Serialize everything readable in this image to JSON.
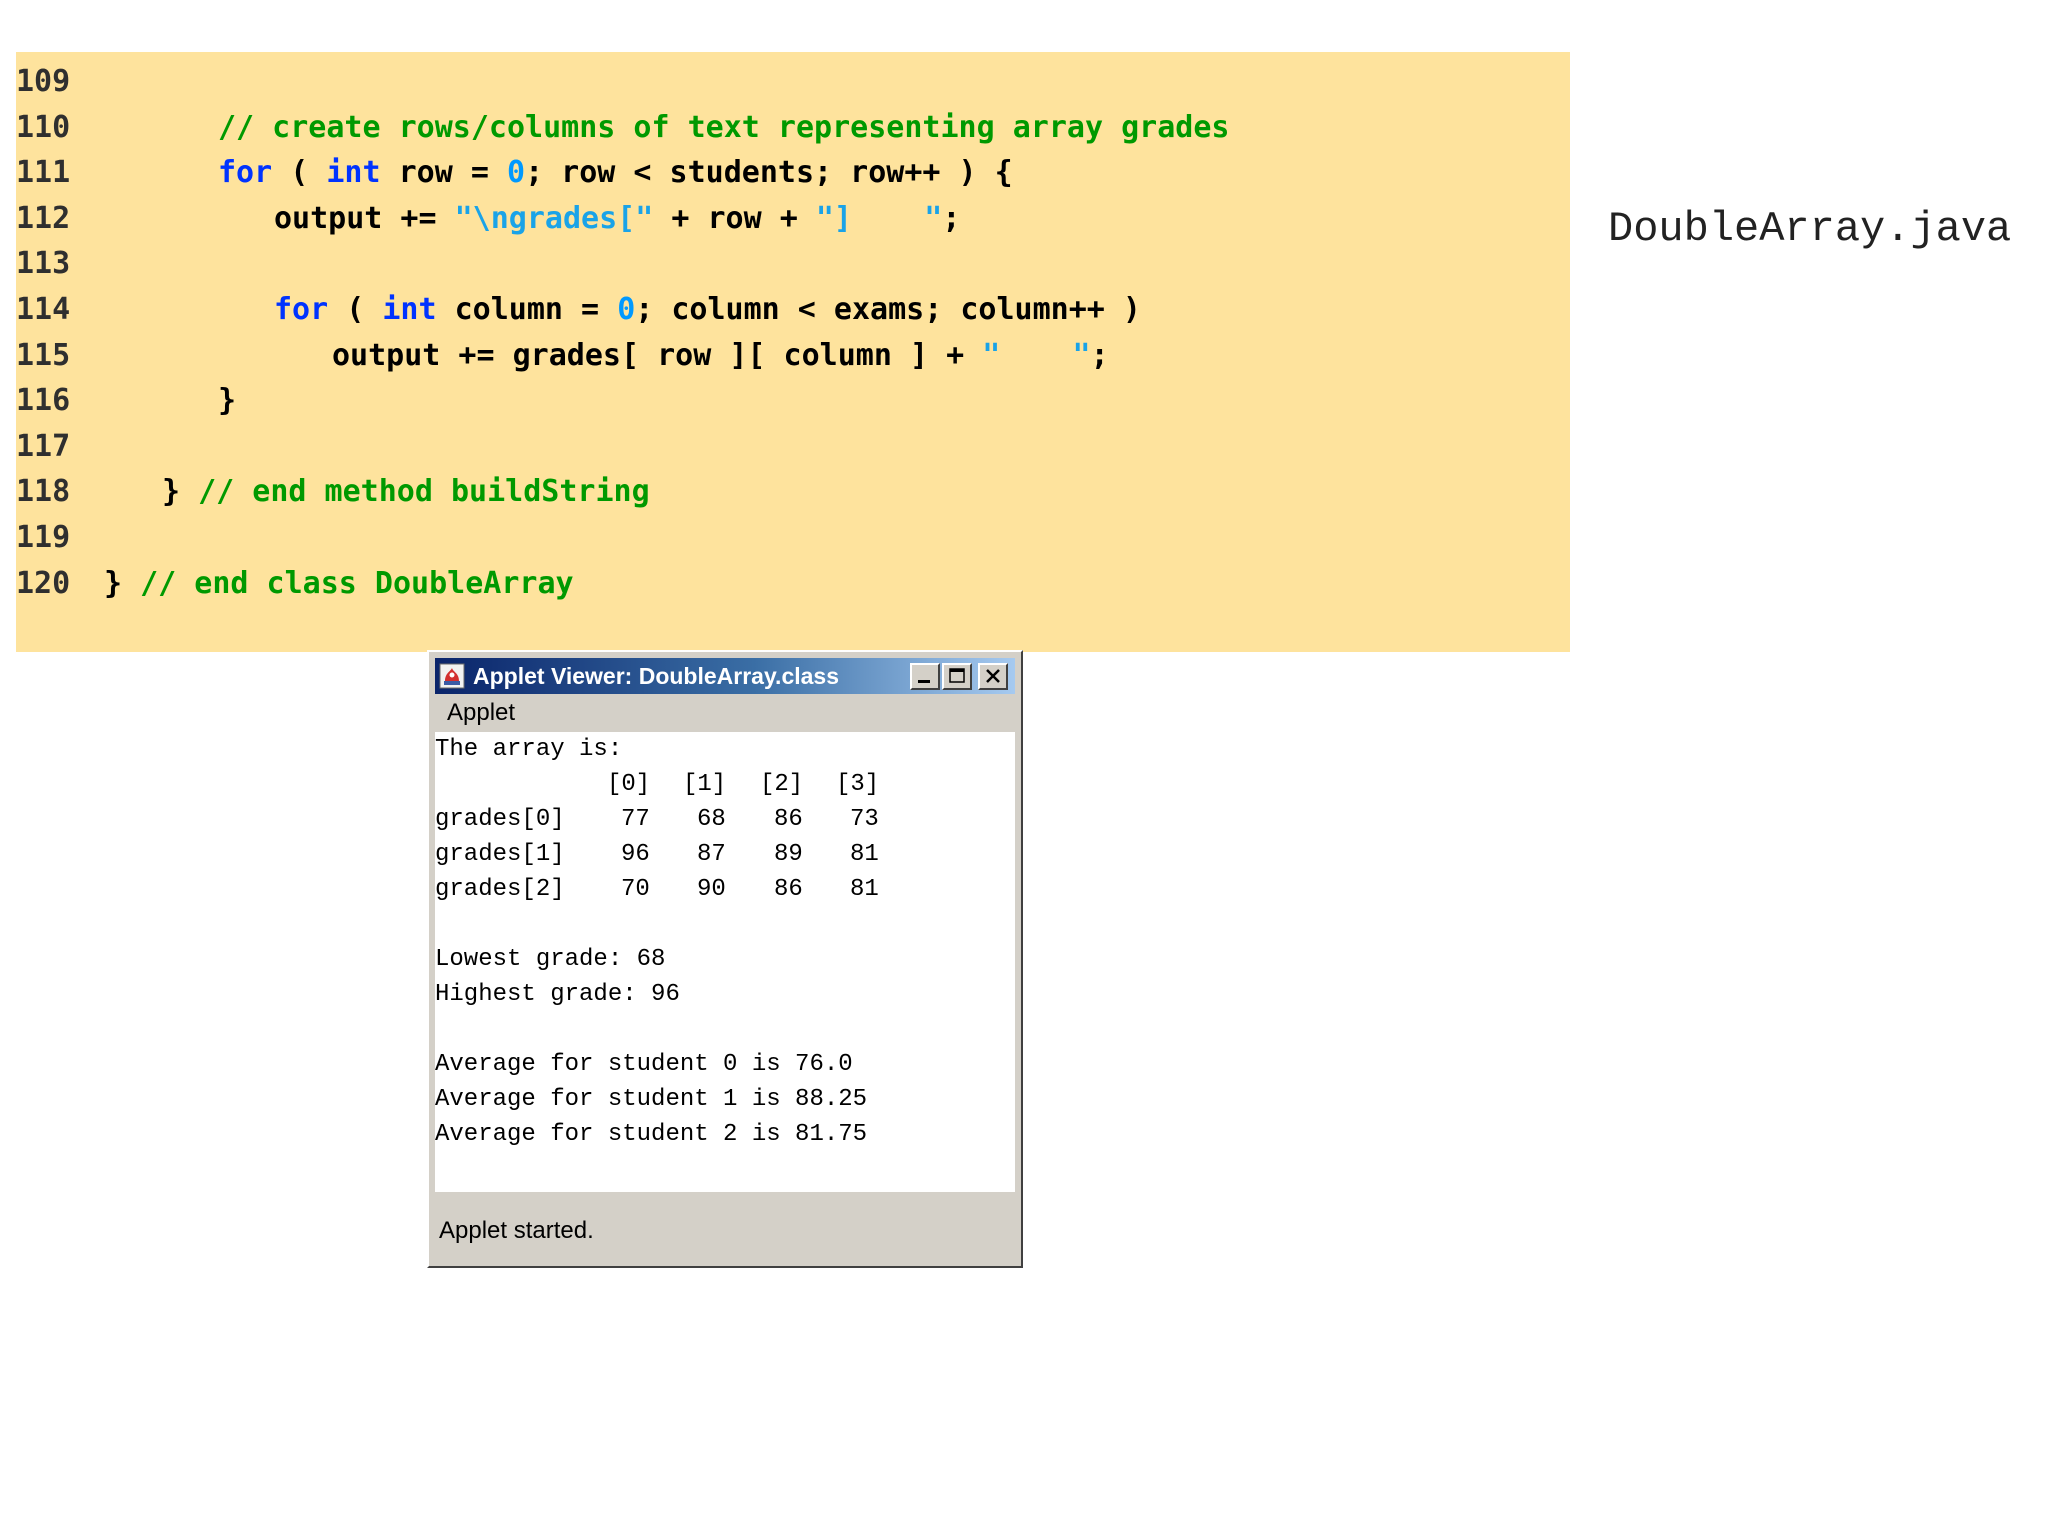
{
  "code": {
    "lines": [
      {
        "num": "109",
        "tokens": []
      },
      {
        "num": "110",
        "tokens": [
          {
            "t": "// create rows/columns of text representing array grades",
            "k": "comment"
          }
        ]
      },
      {
        "num": "111",
        "tokens": [
          {
            "t": "for",
            "k": "kw"
          },
          {
            "t": " ( ",
            "k": "plain"
          },
          {
            "t": "int",
            "k": "kw"
          },
          {
            "t": " row = ",
            "k": "plain"
          },
          {
            "t": "0",
            "k": "num"
          },
          {
            "t": "; row < students; row++ ) {",
            "k": "plain"
          }
        ]
      },
      {
        "num": "112",
        "tokens": [
          {
            "t": "output += ",
            "k": "plain"
          },
          {
            "t": "\"\\ngrades[\"",
            "k": "str"
          },
          {
            "t": " + row + ",
            "k": "plain"
          },
          {
            "t": "\"]    \"",
            "k": "str"
          },
          {
            "t": ";",
            "k": "plain"
          }
        ]
      },
      {
        "num": "113",
        "tokens": []
      },
      {
        "num": "114",
        "tokens": [
          {
            "t": "for",
            "k": "kw"
          },
          {
            "t": " ( ",
            "k": "plain"
          },
          {
            "t": "int",
            "k": "kw"
          },
          {
            "t": " column = ",
            "k": "plain"
          },
          {
            "t": "0",
            "k": "num"
          },
          {
            "t": "; column < exams; column++ )",
            "k": "plain"
          }
        ]
      },
      {
        "num": "115",
        "tokens": [
          {
            "t": "output += grades[ row ][ column ] + ",
            "k": "plain"
          },
          {
            "t": "\"    \"",
            "k": "str"
          },
          {
            "t": ";",
            "k": "plain"
          }
        ]
      },
      {
        "num": "116",
        "tokens": [
          {
            "t": "}",
            "k": "plain"
          }
        ]
      },
      {
        "num": "117",
        "tokens": []
      },
      {
        "num": "118",
        "tokens": [
          {
            "t": "} ",
            "k": "plain"
          },
          {
            "t": "// end method buildString",
            "k": "comment"
          }
        ]
      },
      {
        "num": "119",
        "tokens": []
      },
      {
        "num": "120",
        "tokens": [
          {
            "t": "} ",
            "k": "plain"
          },
          {
            "t": "// end class DoubleArray",
            "k": "comment"
          }
        ]
      }
    ]
  },
  "side_title": "DoubleArray.java",
  "window": {
    "title": "Applet Viewer: DoubleArray.class",
    "menu": [
      "Applet"
    ],
    "status": "Applet started.",
    "icons": [
      "java-applet-icon",
      "minimize-icon",
      "maximize-icon",
      "close-icon"
    ]
  },
  "output": {
    "heading": "The array is:",
    "column_headers": [
      "[0]",
      "[1]",
      "[2]",
      "[3]"
    ],
    "rows": [
      {
        "label": "grades[0]",
        "values": [
          "77",
          "68",
          "86",
          "73"
        ]
      },
      {
        "label": "grades[1]",
        "values": [
          "96",
          "87",
          "89",
          "81"
        ]
      },
      {
        "label": "grades[2]",
        "values": [
          "70",
          "90",
          "86",
          "81"
        ]
      }
    ],
    "lowest": "Lowest grade: 68",
    "highest": "Highest grade: 96",
    "averages": [
      "Average for student 0 is 76.0",
      "Average for student 1 is 88.25",
      "Average for student 2 is 81.75"
    ]
  },
  "colors": {
    "code_background": "#fee39d",
    "comment": "#009900",
    "keyword": "#0033ff",
    "number": "#0099ff",
    "string": "#1aa3e8",
    "titlebar_start": "#0a246a",
    "titlebar_end": "#a6caf0",
    "window_face": "#d4d0c8"
  }
}
